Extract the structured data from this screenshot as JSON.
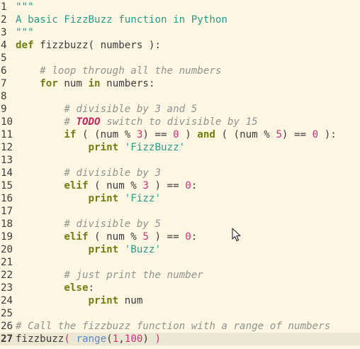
{
  "editor": {
    "current_line": 27,
    "lines": [
      {
        "num": "1",
        "tokens": [
          {
            "t": "\"\"\"",
            "c": "string"
          }
        ]
      },
      {
        "num": "2",
        "tokens": [
          {
            "t": "A basic FizzBuzz function in Python",
            "c": "string"
          }
        ]
      },
      {
        "num": "3",
        "tokens": [
          {
            "t": "\"\"\"",
            "c": "string"
          }
        ]
      },
      {
        "num": "4",
        "tokens": [
          {
            "t": "def",
            "c": "keyword"
          },
          {
            "t": " fizzbuzz( numbers ):",
            "c": "default"
          }
        ]
      },
      {
        "num": "5",
        "tokens": []
      },
      {
        "num": "6",
        "tokens": [
          {
            "t": "    ",
            "c": "default"
          },
          {
            "t": "# loop through all the numbers",
            "c": "comment"
          }
        ]
      },
      {
        "num": "7",
        "tokens": [
          {
            "t": "    ",
            "c": "default"
          },
          {
            "t": "for",
            "c": "keyword"
          },
          {
            "t": " num ",
            "c": "default"
          },
          {
            "t": "in",
            "c": "keyword"
          },
          {
            "t": " numbers:",
            "c": "default"
          }
        ]
      },
      {
        "num": "8",
        "tokens": []
      },
      {
        "num": "9",
        "tokens": [
          {
            "t": "        ",
            "c": "default"
          },
          {
            "t": "# divisible by 3 and 5",
            "c": "comment"
          }
        ]
      },
      {
        "num": "10",
        "tokens": [
          {
            "t": "        ",
            "c": "default"
          },
          {
            "t": "# ",
            "c": "comment"
          },
          {
            "t": "TODO",
            "c": "todo"
          },
          {
            "t": " switch to divisible by 15",
            "c": "comment"
          }
        ]
      },
      {
        "num": "11",
        "tokens": [
          {
            "t": "        ",
            "c": "default"
          },
          {
            "t": "if",
            "c": "keyword"
          },
          {
            "t": " ( (num % ",
            "c": "default"
          },
          {
            "t": "3",
            "c": "number"
          },
          {
            "t": ") == ",
            "c": "default"
          },
          {
            "t": "0",
            "c": "number"
          },
          {
            "t": " ) ",
            "c": "default"
          },
          {
            "t": "and",
            "c": "keyword"
          },
          {
            "t": " ( (num % ",
            "c": "default"
          },
          {
            "t": "5",
            "c": "number"
          },
          {
            "t": ") == ",
            "c": "default"
          },
          {
            "t": "0",
            "c": "number"
          },
          {
            "t": " ):",
            "c": "default"
          }
        ]
      },
      {
        "num": "12",
        "tokens": [
          {
            "t": "            ",
            "c": "default"
          },
          {
            "t": "print",
            "c": "keyword"
          },
          {
            "t": " ",
            "c": "default"
          },
          {
            "t": "'FizzBuzz'",
            "c": "string"
          }
        ]
      },
      {
        "num": "13",
        "tokens": []
      },
      {
        "num": "14",
        "tokens": [
          {
            "t": "        ",
            "c": "default"
          },
          {
            "t": "# divisible by 3",
            "c": "comment"
          }
        ]
      },
      {
        "num": "15",
        "tokens": [
          {
            "t": "        ",
            "c": "default"
          },
          {
            "t": "elif",
            "c": "keyword"
          },
          {
            "t": " ( num % ",
            "c": "default"
          },
          {
            "t": "3",
            "c": "number"
          },
          {
            "t": " ) == ",
            "c": "default"
          },
          {
            "t": "0",
            "c": "number"
          },
          {
            "t": ":",
            "c": "default"
          }
        ]
      },
      {
        "num": "16",
        "tokens": [
          {
            "t": "            ",
            "c": "default"
          },
          {
            "t": "print",
            "c": "keyword"
          },
          {
            "t": " ",
            "c": "default"
          },
          {
            "t": "'Fizz'",
            "c": "string"
          }
        ]
      },
      {
        "num": "17",
        "tokens": []
      },
      {
        "num": "18",
        "tokens": [
          {
            "t": "        ",
            "c": "default"
          },
          {
            "t": "# divisible by 5",
            "c": "comment"
          }
        ]
      },
      {
        "num": "19",
        "tokens": [
          {
            "t": "        ",
            "c": "default"
          },
          {
            "t": "elif",
            "c": "keyword"
          },
          {
            "t": " ( num % ",
            "c": "default"
          },
          {
            "t": "5",
            "c": "number"
          },
          {
            "t": " ) == ",
            "c": "default"
          },
          {
            "t": "0",
            "c": "number"
          },
          {
            "t": ":",
            "c": "default"
          }
        ]
      },
      {
        "num": "20",
        "tokens": [
          {
            "t": "            ",
            "c": "default"
          },
          {
            "t": "print",
            "c": "keyword"
          },
          {
            "t": " ",
            "c": "default"
          },
          {
            "t": "'Buzz'",
            "c": "string"
          }
        ]
      },
      {
        "num": "21",
        "tokens": []
      },
      {
        "num": "22",
        "tokens": [
          {
            "t": "        ",
            "c": "default"
          },
          {
            "t": "# just print the number",
            "c": "comment"
          }
        ]
      },
      {
        "num": "23",
        "tokens": [
          {
            "t": "        ",
            "c": "default"
          },
          {
            "t": "else",
            "c": "keyword"
          },
          {
            "t": ":",
            "c": "default"
          }
        ]
      },
      {
        "num": "24",
        "tokens": [
          {
            "t": "            ",
            "c": "default"
          },
          {
            "t": "print",
            "c": "keyword"
          },
          {
            "t": " num",
            "c": "default"
          }
        ]
      },
      {
        "num": "25",
        "tokens": []
      },
      {
        "num": "26",
        "tokens": [
          {
            "t": "# Call the fizzbuzz function with a range of numbers",
            "c": "comment"
          }
        ]
      },
      {
        "num": "27",
        "tokens": [
          {
            "t": "fizzbuzz",
            "c": "default"
          },
          {
            "t": "(",
            "c": "paren-red"
          },
          {
            "t": " ",
            "c": "default"
          },
          {
            "t": "range",
            "c": "builtin"
          },
          {
            "t": "(",
            "c": "default"
          },
          {
            "t": "1",
            "c": "number"
          },
          {
            "t": ",",
            "c": "default"
          },
          {
            "t": "100",
            "c": "number"
          },
          {
            "t": ") ",
            "c": "default"
          },
          {
            "t": ")",
            "c": "paren-red"
          }
        ]
      }
    ]
  },
  "cursor": {
    "icon": "mouse-pointer-icon"
  },
  "colors": {
    "background": "#fdf6e3",
    "current_line": "#ece7d2",
    "keyword": "#6f7f12",
    "string": "#2a9a87",
    "comment": "#8f958f",
    "number": "#d22e78",
    "builtin": "#5a8cc4",
    "todo": "#c8245c"
  }
}
